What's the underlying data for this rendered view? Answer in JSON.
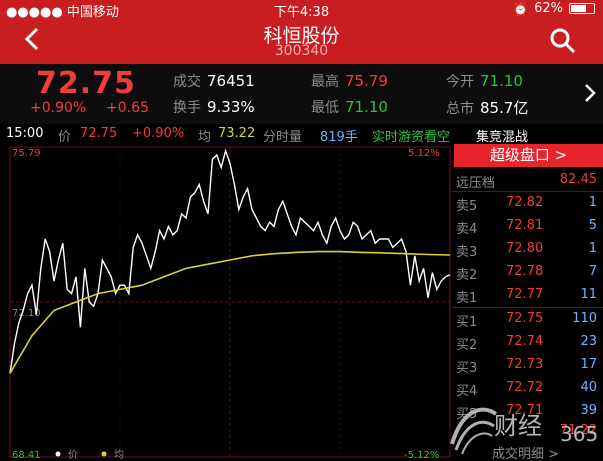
{
  "status_bar": {
    "carrier": "●●●●● 中国移动",
    "time": "下午4:38",
    "battery": "62%",
    "battery_level": 0.62
  },
  "nav": {
    "title": "科恒股份",
    "code": "300340"
  },
  "quote": {
    "price": "72.75",
    "change_pct": "+0.90%",
    "change_abs": "+0.65",
    "volume_label": "成交",
    "volume": "76451",
    "high_label": "最高",
    "high": "75.79",
    "open_label": "今开",
    "open": "71.10",
    "turnover_label": "换手",
    "turnover": "9.33%",
    "low_label": "最低",
    "low": "71.10",
    "mktcap_label": "总市",
    "mktcap": "85.7亿"
  },
  "info_row": {
    "time": "15:00",
    "price_label": "价",
    "price": "72.75",
    "pct": "+0.90%",
    "avg_label": "均",
    "avg": "73.22",
    "vol_label": "分时量",
    "vol": "819手",
    "game_label": "实时游资看空",
    "auction_label": "集竞混战"
  },
  "chart_labels": {
    "y_top": "75.79",
    "y_bottom": "68.41",
    "y_mid": "72.10",
    "pct_top": "5.12%",
    "pct_bottom": "-5.12%",
    "legend_price": "价",
    "legend_avg": "均"
  },
  "chart_data": {
    "type": "line",
    "title": "",
    "ylim": [
      68.41,
      75.79
    ],
    "y_mid": 72.1,
    "xlim": [
      0,
      100
    ],
    "series": [
      {
        "name": "价",
        "color": "#ffffff",
        "x": [
          0,
          1,
          2,
          3,
          4,
          5,
          6,
          7,
          8,
          9,
          10,
          11,
          12,
          13,
          14,
          15,
          16,
          17,
          18,
          19,
          20,
          21,
          22,
          23,
          24,
          25,
          26,
          27,
          28,
          29,
          30,
          31,
          32,
          33,
          34,
          35,
          36,
          37,
          38,
          39,
          40,
          41,
          42,
          43,
          44,
          45,
          46,
          47,
          48,
          49,
          50,
          51,
          52,
          53,
          54,
          55,
          56,
          57,
          58,
          59,
          60,
          61,
          62,
          63,
          64,
          65,
          66,
          67,
          68,
          69,
          70,
          71,
          72,
          73,
          74,
          75,
          76,
          77,
          78,
          79,
          80,
          81,
          82,
          83,
          84,
          85,
          86,
          87,
          88,
          89,
          90,
          91,
          92,
          93,
          94,
          95,
          96,
          97,
          98,
          99,
          100
        ],
        "values": [
          70.4,
          71.1,
          71.6,
          71.9,
          72.3,
          72.5,
          71.8,
          72.9,
          73.6,
          73.3,
          72.6,
          73.1,
          73.5,
          72.4,
          72.3,
          72.7,
          71.5,
          72.9,
          72.1,
          72.0,
          72.3,
          73.1,
          72.9,
          72.7,
          72.3,
          72.5,
          72.5,
          72.3,
          73.4,
          73.7,
          73.5,
          73.2,
          72.9,
          73.3,
          73.8,
          73.6,
          73.9,
          73.7,
          73.8,
          74.2,
          74.1,
          74.6,
          74.7,
          74.9,
          74.5,
          74.2,
          75.5,
          75.6,
          75.3,
          75.7,
          75.4,
          74.9,
          74.3,
          74.6,
          74.8,
          74.3,
          74.1,
          73.9,
          73.8,
          74.0,
          73.9,
          74.3,
          74.5,
          74.2,
          73.9,
          73.7,
          74.1,
          74.0,
          73.9,
          73.8,
          74.0,
          73.7,
          73.5,
          73.9,
          74.1,
          73.8,
          73.6,
          73.7,
          74.0,
          73.9,
          73.6,
          73.7,
          73.8,
          73.5,
          73.6,
          73.6,
          73.6,
          73.4,
          73.5,
          73.6,
          73.3,
          72.5,
          73.2,
          72.6,
          72.9,
          72.2,
          72.8,
          72.4,
          72.6,
          72.7,
          72.75
        ]
      },
      {
        "name": "均",
        "color": "#d4d43a",
        "x": [
          0,
          5,
          10,
          15,
          20,
          25,
          30,
          35,
          40,
          45,
          50,
          55,
          60,
          65,
          70,
          75,
          80,
          85,
          90,
          95,
          100
        ],
        "values": [
          70.4,
          71.3,
          71.9,
          72.1,
          72.3,
          72.4,
          72.5,
          72.7,
          72.9,
          73.0,
          73.1,
          73.2,
          73.25,
          73.28,
          73.3,
          73.3,
          73.28,
          73.27,
          73.25,
          73.23,
          73.22
        ]
      }
    ]
  },
  "order_book": {
    "header": "超级盘口 >",
    "pressure_label": "远压档",
    "pressure_price": "82.45",
    "asks": [
      {
        "label": "卖5",
        "price": "72.82",
        "vol": "1"
      },
      {
        "label": "卖4",
        "price": "72.81",
        "vol": "5"
      },
      {
        "label": "卖3",
        "price": "72.80",
        "vol": "1"
      },
      {
        "label": "卖2",
        "price": "72.78",
        "vol": "7"
      },
      {
        "label": "卖1",
        "price": "72.77",
        "vol": "11"
      }
    ],
    "bids": [
      {
        "label": "买1",
        "price": "72.75",
        "vol": "110"
      },
      {
        "label": "买2",
        "price": "72.74",
        "vol": "23"
      },
      {
        "label": "买3",
        "price": "72.73",
        "vol": "17"
      },
      {
        "label": "买4",
        "price": "72.72",
        "vol": "40"
      },
      {
        "label": "买5",
        "price": "72.71",
        "vol": "39"
      }
    ],
    "support_price": "71.22",
    "footer": "成交明细 >"
  },
  "watermark": {
    "text": "财经",
    "num": "365"
  },
  "colors": {
    "brand_red": "#c91e21",
    "up_red": "#f23b3b",
    "down_green": "#23c53c",
    "volume_blue": "#6fb4ff",
    "avg_yellow": "#d4d43a"
  }
}
